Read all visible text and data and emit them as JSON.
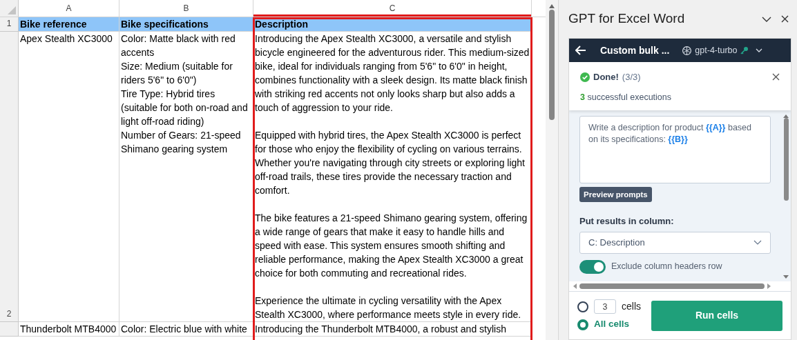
{
  "sheet": {
    "columns": [
      {
        "label": "A",
        "outlined": false
      },
      {
        "label": "B",
        "outlined": false
      },
      {
        "label": "C",
        "outlined": true
      }
    ],
    "rows": [
      {
        "number": "1",
        "header": true,
        "cells": [
          {
            "paragraphs": [
              "Bike reference"
            ]
          },
          {
            "paragraphs": [
              "Bike specifications"
            ]
          },
          {
            "paragraphs": [
              "Description"
            ]
          }
        ]
      },
      {
        "number": "2",
        "header": false,
        "cells": [
          {
            "paragraphs": [
              "Apex Stealth XC3000"
            ]
          },
          {
            "paragraphs": [
              "Color: Matte black with red accents",
              "Size: Medium (suitable for riders 5'6\" to 6'0\")",
              "Tire Type: Hybrid tires (suitable for both on-road and light off-road riding)",
              "Number of Gears: 21-speed Shimano gearing system"
            ]
          },
          {
            "paragraphs": [
              "Introducing the Apex Stealth XC3000, a versatile and stylish bicycle engineered for the adventurous rider. This medium-sized bike, ideal for individuals ranging from 5'6\" to 6'0\" in height, combines functionality with a sleek design. Its matte black finish with striking red accents not only looks sharp but also adds a touch of aggression to your ride.",
              "Equipped with hybrid tires, the Apex Stealth XC3000 is perfect for those who enjoy the flexibility of cycling on various terrains. Whether you're navigating through city streets or exploring light off-road trails, these tires provide the necessary traction and comfort.",
              "The bike features a 21-speed Shimano gearing system, offering a wide range of gears that make it easy to handle hills and speed with ease. This system ensures smooth shifting and reliable performance, making the Apex Stealth XC3000 a great choice for both commuting and recreational rides.",
              "Experience the ultimate in cycling versatility with the Apex Stealth XC3000, where performance meets style in every ride."
            ]
          }
        ]
      },
      {
        "number": "",
        "header": false,
        "cells": [
          {
            "paragraphs": [
              "Thunderbolt MTB4000"
            ]
          },
          {
            "paragraphs": [
              "Color: Electric blue with white"
            ]
          },
          {
            "paragraphs": [
              "Introducing the Thunderbolt MTB4000, a robust and stylish"
            ]
          }
        ]
      }
    ]
  },
  "pane": {
    "title": "GPT for Excel Word",
    "header": {
      "title": "Custom bulk ...",
      "model": "gpt-4-turbo"
    },
    "notification": {
      "title": "Done!",
      "count": "(3/3)",
      "detail": "**3** successful executions"
    },
    "prompt": "Write a description for product **{{A}}** based on its specifications: **{{B}}**",
    "preview_button": "Preview prompts",
    "column_label": "Put results in column:",
    "column_value": "C: Description",
    "exclude_headers": {
      "label": "Exclude column headers row",
      "on": true
    },
    "scope": [
      {
        "kind": "count",
        "value": "3",
        "label": "cells",
        "selected": false
      },
      {
        "kind": "all",
        "label": "All cells",
        "selected": true
      }
    ],
    "run_button": "Run cells"
  }
}
